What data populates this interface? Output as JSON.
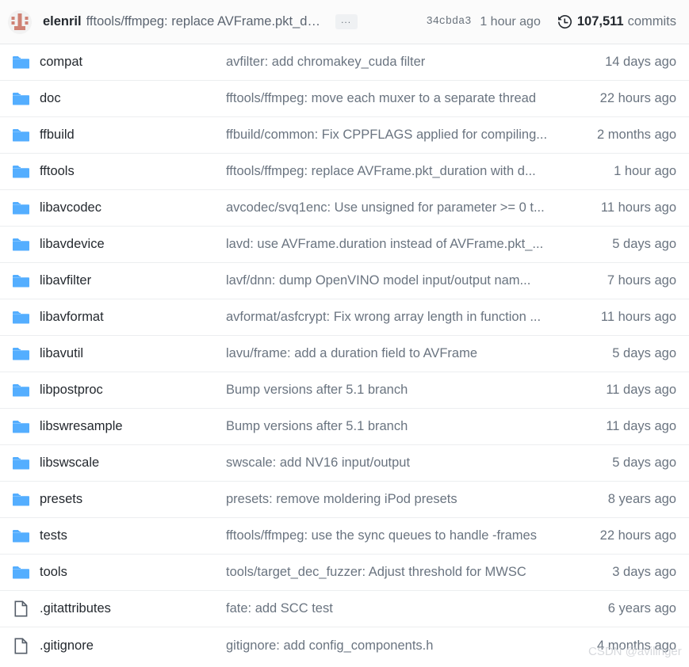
{
  "header": {
    "avatar_name": "identicon-avatar",
    "author": "elenril",
    "commit_message": "fftools/ffmpeg: replace AVFrame.pkt_duratio...",
    "ellipsis_label": "...",
    "commit_sha": "34cbda3",
    "commit_date": "1 hour ago",
    "history_icon": "history-clock-icon",
    "commits_count": "107,511",
    "commits_label": "commits",
    "colors": {
      "avatar_fg": "#cf8275",
      "avatar_bg": "#f2f2f2",
      "folder_icon": "#54aeff",
      "file_icon": "#545d68",
      "name_text": "#24292f",
      "muted_text": "#6a7480",
      "row_border": "#eceef0",
      "header_bg": "#fbfbfb"
    }
  },
  "watermark": "CSDN @avilinger",
  "files": [
    {
      "type": "folder",
      "icon": "folder-icon",
      "name": "compat",
      "message": "avfilter: add chromakey_cuda filter",
      "time": "14 days ago"
    },
    {
      "type": "folder",
      "icon": "folder-icon",
      "name": "doc",
      "message": "fftools/ffmpeg: move each muxer to a separate thread",
      "time": "22 hours ago"
    },
    {
      "type": "folder",
      "icon": "folder-icon",
      "name": "ffbuild",
      "message": "ffbuild/common: Fix CPPFLAGS applied for compiling...",
      "time": "2 months ago"
    },
    {
      "type": "folder",
      "icon": "folder-icon",
      "name": "fftools",
      "message": "fftools/ffmpeg: replace AVFrame.pkt_duration with d...",
      "time": "1 hour ago"
    },
    {
      "type": "folder",
      "icon": "folder-icon",
      "name": "libavcodec",
      "message": "avcodec/svq1enc: Use unsigned for parameter >= 0 t...",
      "time": "11 hours ago"
    },
    {
      "type": "folder",
      "icon": "folder-icon",
      "name": "libavdevice",
      "message": "lavd: use AVFrame.duration instead of AVFrame.pkt_...",
      "time": "5 days ago"
    },
    {
      "type": "folder",
      "icon": "folder-icon",
      "name": "libavfilter",
      "message": "lavf/dnn: dump OpenVINO model input/output nam...",
      "time": "7 hours ago"
    },
    {
      "type": "folder",
      "icon": "folder-icon",
      "name": "libavformat",
      "message": "avformat/asfcrypt: Fix wrong array length in function ...",
      "time": "11 hours ago"
    },
    {
      "type": "folder",
      "icon": "folder-icon",
      "name": "libavutil",
      "message": "lavu/frame: add a duration field to AVFrame",
      "time": "5 days ago"
    },
    {
      "type": "folder",
      "icon": "folder-icon",
      "name": "libpostproc",
      "message": "Bump versions after 5.1 branch",
      "time": "11 days ago"
    },
    {
      "type": "folder",
      "icon": "folder-icon",
      "name": "libswresample",
      "message": "Bump versions after 5.1 branch",
      "time": "11 days ago"
    },
    {
      "type": "folder",
      "icon": "folder-icon",
      "name": "libswscale",
      "message": "swscale: add NV16 input/output",
      "time": "5 days ago"
    },
    {
      "type": "folder",
      "icon": "folder-icon",
      "name": "presets",
      "message": "presets: remove moldering iPod presets",
      "time": "8 years ago"
    },
    {
      "type": "folder",
      "icon": "folder-icon",
      "name": "tests",
      "message": "fftools/ffmpeg: use the sync queues to handle -frames",
      "time": "22 hours ago"
    },
    {
      "type": "folder",
      "icon": "folder-icon",
      "name": "tools",
      "message": "tools/target_dec_fuzzer: Adjust threshold for MWSC",
      "time": "3 days ago"
    },
    {
      "type": "file",
      "icon": "file-icon",
      "name": ".gitattributes",
      "message": "fate: add SCC test",
      "time": "6 years ago"
    },
    {
      "type": "file",
      "icon": "file-icon",
      "name": ".gitignore",
      "message": "gitignore: add config_components.h",
      "time": "4 months ago"
    }
  ]
}
